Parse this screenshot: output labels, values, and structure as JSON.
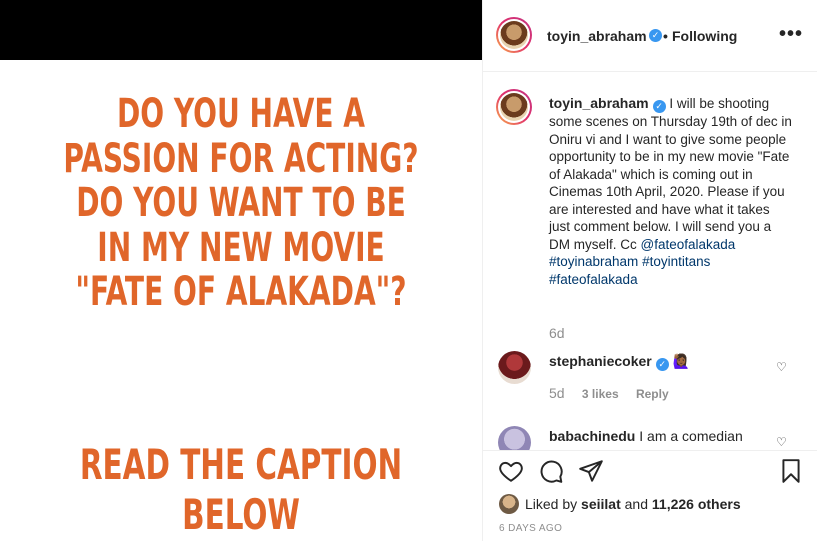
{
  "post_image": {
    "headline_lines": [
      "DO YOU HAVE A",
      "PASSION FOR ACTING?",
      "DO YOU WANT TO BE",
      "IN MY NEW MOVIE",
      "\"FATE OF ALAKADA\"?"
    ],
    "cta": "READ THE CAPTION BELOW",
    "text_color": "#e0662a",
    "top_bar_color": "#000000"
  },
  "header": {
    "username": "toyin_abraham",
    "dot": "•",
    "follow_status": "Following",
    "more_label": "•••"
  },
  "caption": {
    "username": "toyin_abraham",
    "body": "I will be shooting some scenes on Thursday 19th of dec in Oniru vi and I want to give some people opportunity to be in my new movie \"Fate of Alakada\" which is coming out in Cinemas 10th April, 2020. Please if you are interested and have what it takes just comment below. I will send you a DM myself. Cc",
    "mention": "@fateofalakada",
    "hashtags": [
      "#toyinabraham",
      "#toyintitans",
      "#fateofalakada"
    ],
    "age": "6d"
  },
  "comments": [
    {
      "username": "stephaniecoker",
      "text": "🙋🏾‍♀️",
      "age": "5d",
      "likes": "3 likes",
      "reply_label": "Reply"
    },
    {
      "username": "babachinedu",
      "text": "I am a comedian"
    }
  ],
  "actions": {
    "liked_by_prefix": "Liked by",
    "liked_by_user": "seiilat",
    "and_word": "and",
    "others": "11,226 others",
    "timestamp": "6 DAYS AGO"
  },
  "colors": {
    "verified": "#3897f0",
    "link": "#00376b",
    "muted": "#8e8e8e"
  }
}
